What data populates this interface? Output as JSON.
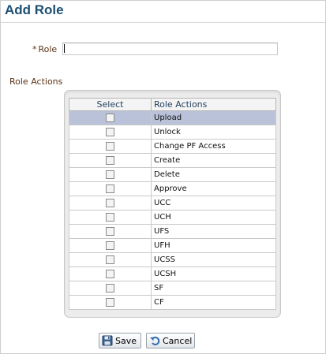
{
  "page": {
    "title": "Add Role"
  },
  "form": {
    "required_marker": "*",
    "role_label": "Role",
    "role_value": "",
    "actions_label": "Role Actions"
  },
  "table": {
    "headers": {
      "select": "Select",
      "action": "Role Actions"
    },
    "rows": [
      {
        "label": "Upload",
        "checked": false,
        "selected": true
      },
      {
        "label": "Unlock",
        "checked": false,
        "selected": false
      },
      {
        "label": "Change PF Access",
        "checked": false,
        "selected": false
      },
      {
        "label": "Create",
        "checked": false,
        "selected": false
      },
      {
        "label": "Delete",
        "checked": false,
        "selected": false
      },
      {
        "label": "Approve",
        "checked": false,
        "selected": false
      },
      {
        "label": "UCC",
        "checked": false,
        "selected": false
      },
      {
        "label": "UCH",
        "checked": false,
        "selected": false
      },
      {
        "label": "UFS",
        "checked": false,
        "selected": false
      },
      {
        "label": "UFH",
        "checked": false,
        "selected": false
      },
      {
        "label": "UCSS",
        "checked": false,
        "selected": false
      },
      {
        "label": "UCSH",
        "checked": false,
        "selected": false
      },
      {
        "label": "SF",
        "checked": false,
        "selected": false
      },
      {
        "label": "CF",
        "checked": false,
        "selected": false
      }
    ]
  },
  "buttons": {
    "save": {
      "label": "Save",
      "icon": "floppy-disk-icon"
    },
    "cancel": {
      "label": "Cancel",
      "icon": "undo-arrow-icon"
    }
  },
  "colors": {
    "title": "#1b4f72",
    "label": "#5c3317",
    "selected_row": "#b9c2d9"
  }
}
